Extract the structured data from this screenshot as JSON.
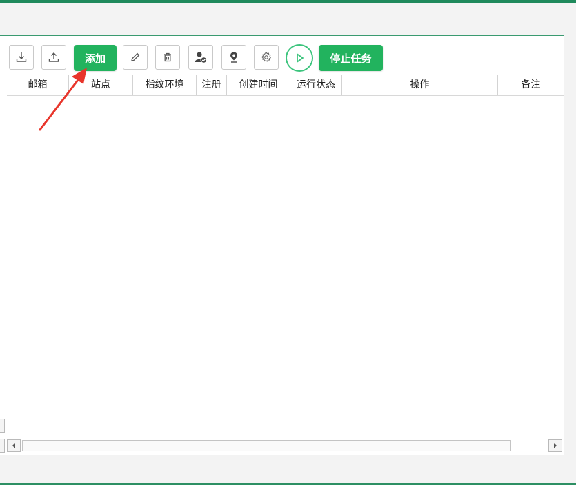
{
  "toolbar": {
    "add_label": "添加",
    "stop_label": "停止任务"
  },
  "table": {
    "columns": [
      "邮箱",
      "站点",
      "指纹环境",
      "注册",
      "创建时间",
      "运行状态",
      "操作",
      "备注"
    ],
    "rows": []
  },
  "colors": {
    "accent_green": "#22b35e",
    "annotation_red": "#e8352b"
  },
  "icons": [
    "download-icon",
    "upload-icon",
    "pencil-icon",
    "trash-icon",
    "user-check-icon",
    "location-pin-icon",
    "gear-icon",
    "play-icon"
  ]
}
